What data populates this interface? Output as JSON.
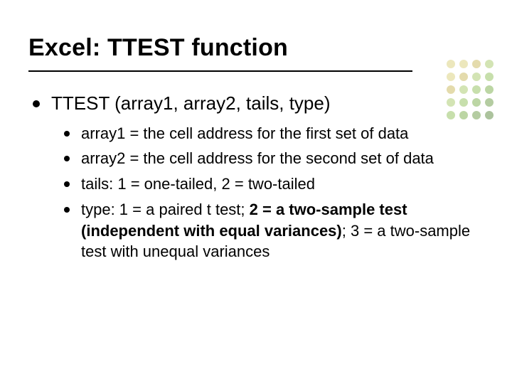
{
  "title": "Excel: TTEST function",
  "main_point": "TTEST (array1, array2, tails, type)",
  "sub_points": [
    {
      "segments": [
        {
          "t": "array1 = the cell address for the first set of data",
          "b": false
        }
      ]
    },
    {
      "segments": [
        {
          "t": "array2 = the cell address for the second set of data",
          "b": false
        }
      ]
    },
    {
      "segments": [
        {
          "t": "tails: 1 = one-tailed, 2 = two-tailed",
          "b": false
        }
      ]
    },
    {
      "segments": [
        {
          "t": "type: 1 = a paired t test; ",
          "b": false
        },
        {
          "t": "2 = a two-sample test (independent with equal variances)",
          "b": true
        },
        {
          "t": "; 3 = a two-sample test with unequal variances",
          "b": false
        }
      ]
    }
  ],
  "dot_colors": [
    "#d9d07a",
    "#d9d07a",
    "#c9b85a",
    "#a8c96a",
    "#d9d07a",
    "#c9b85a",
    "#a8c96a",
    "#8fbf5a",
    "#c9b85a",
    "#a8c96a",
    "#8fbf5a",
    "#7aae4a",
    "#a8c96a",
    "#8fbf5a",
    "#7aae4a",
    "#6a9a44",
    "#8fbf5a",
    "#7aae4a",
    "#6a9a44",
    "#5a873c"
  ]
}
